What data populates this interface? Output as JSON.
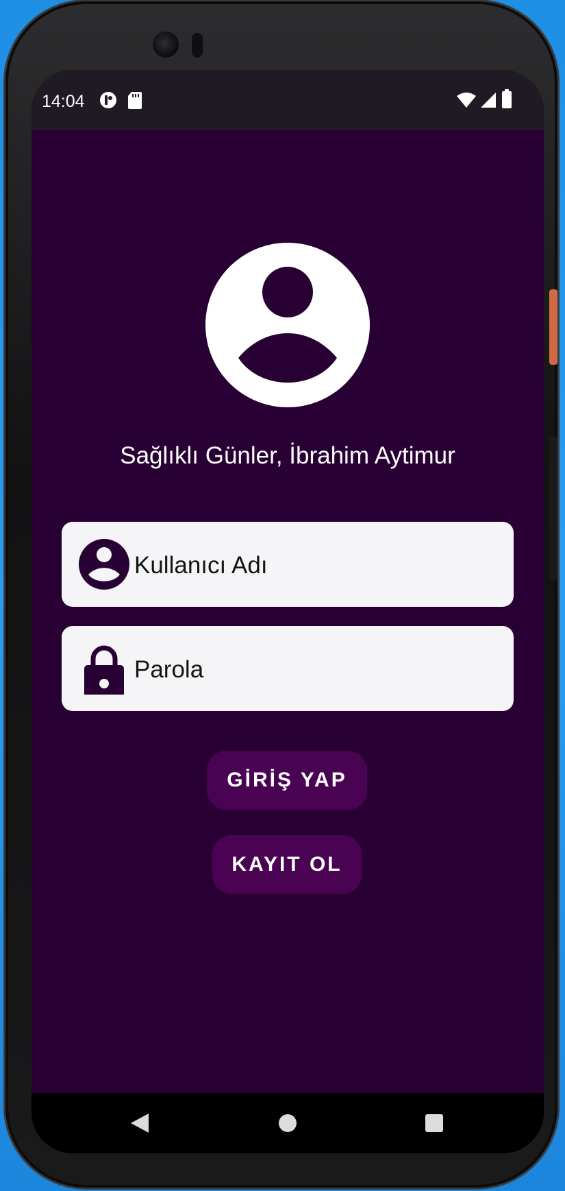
{
  "status_bar": {
    "time": "14:04",
    "notification_icons": [
      "sync-cloud-icon",
      "sd-card-icon"
    ],
    "system_icons": [
      "wifi-icon",
      "cellular-signal-icon",
      "battery-icon"
    ]
  },
  "login": {
    "avatar_icon": "account-circle-icon",
    "greeting": "Sağlıklı Günler, İbrahim Aytimur",
    "username_placeholder": "Kullanıcı Adı",
    "password_placeholder": "Parola",
    "login_button": "GİRİŞ YAP",
    "register_button": "KAYIT OL"
  },
  "nav_bar": {
    "icons": [
      "back-icon",
      "home-icon",
      "recents-icon"
    ]
  },
  "colors": {
    "app_background": "#290033",
    "button_background": "#4a0353",
    "field_background": "#f5f4f7",
    "status_bar": "#1f1a24",
    "text_light": "#ffffff"
  }
}
